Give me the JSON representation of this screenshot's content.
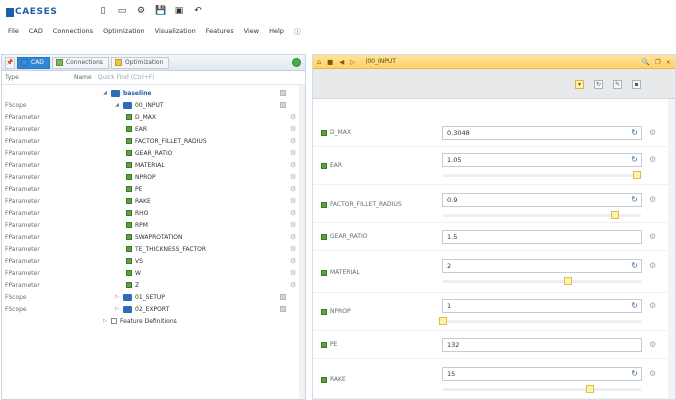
{
  "app": {
    "logo_text": "CAESES",
    "quick_access": [
      "▯",
      "▭",
      "⚙",
      "💾",
      "▣",
      "↶"
    ]
  },
  "menu": [
    "File",
    "CAD",
    "Connections",
    "Optimization",
    "Visualization",
    "Features",
    "View",
    "Help",
    "ⓘ"
  ],
  "left": {
    "tabs": [
      {
        "label": "CAD",
        "active": true
      },
      {
        "label": "Connections",
        "active": false
      },
      {
        "label": "Optimization",
        "active": false
      }
    ],
    "header": {
      "type": "Type",
      "name": "Name",
      "filter_placeholder": "Quick Find (Ctrl+F)"
    },
    "rows": [
      {
        "type": "",
        "label": "baseline",
        "kind": "folder",
        "indent": 0,
        "expanded": true,
        "sm": true
      },
      {
        "type": "FScope",
        "label": "00_INPUT",
        "kind": "folder",
        "indent": 1,
        "expanded": true,
        "sm": true
      },
      {
        "type": "FParameter",
        "label": "D_MAX",
        "kind": "param",
        "indent": 2
      },
      {
        "type": "FParameter",
        "label": "EAR",
        "kind": "param",
        "indent": 2
      },
      {
        "type": "FParameter",
        "label": "FACTOR_FILLET_RADIUS",
        "kind": "param",
        "indent": 2
      },
      {
        "type": "FParameter",
        "label": "GEAR_RATIO",
        "kind": "param",
        "indent": 2
      },
      {
        "type": "FParameter",
        "label": "MATERIAL",
        "kind": "param",
        "indent": 2
      },
      {
        "type": "FParameter",
        "label": "NPROP",
        "kind": "param",
        "indent": 2
      },
      {
        "type": "FParameter",
        "label": "PE",
        "kind": "param",
        "indent": 2
      },
      {
        "type": "FParameter",
        "label": "RAKE",
        "kind": "param",
        "indent": 2
      },
      {
        "type": "FParameter",
        "label": "RHO",
        "kind": "param",
        "indent": 2
      },
      {
        "type": "FParameter",
        "label": "RPM",
        "kind": "param",
        "indent": 2
      },
      {
        "type": "FParameter",
        "label": "SWAPROTATION",
        "kind": "param",
        "indent": 2
      },
      {
        "type": "FParameter",
        "label": "TE_THICKNESS_FACTOR",
        "kind": "param",
        "indent": 2
      },
      {
        "type": "FParameter",
        "label": "VS",
        "kind": "param",
        "indent": 2
      },
      {
        "type": "FParameter",
        "label": "W",
        "kind": "param",
        "indent": 2
      },
      {
        "type": "FParameter",
        "label": "Z",
        "kind": "param",
        "indent": 2
      },
      {
        "type": "FScope",
        "label": "01_SETUP",
        "kind": "folder",
        "indent": 1,
        "expanded": false,
        "sm": true
      },
      {
        "type": "FScope",
        "label": "02_EXPORT",
        "kind": "folder",
        "indent": 1,
        "expanded": false,
        "sm": true
      },
      {
        "type": "",
        "label": "Feature Definitions",
        "kind": "feature",
        "indent": 0,
        "expanded": false
      }
    ]
  },
  "right": {
    "path": "|00_INPUT",
    "params": [
      {
        "label": "D_MAX",
        "value": "0.3048",
        "slider": null
      },
      {
        "label": "EAR",
        "value": "1.05",
        "slider": 0.98
      },
      {
        "label": "FACTOR_FILLET_RADIUS",
        "value": "0.9",
        "slider": 0.87
      },
      {
        "label": "GEAR_RATIO",
        "value": "1.5",
        "slider": null
      },
      {
        "label": "MATERIAL",
        "value": "2",
        "slider": 0.63
      },
      {
        "label": "NPROP",
        "value": "1",
        "slider": 0.0
      },
      {
        "label": "PE",
        "value": "132",
        "slider": null
      },
      {
        "label": "RAKE",
        "value": "15",
        "slider": 0.74
      }
    ]
  },
  "colors": {
    "accent": "#2f87d6",
    "header_yellow": "#ffd466",
    "param_green": "#59a33d"
  }
}
